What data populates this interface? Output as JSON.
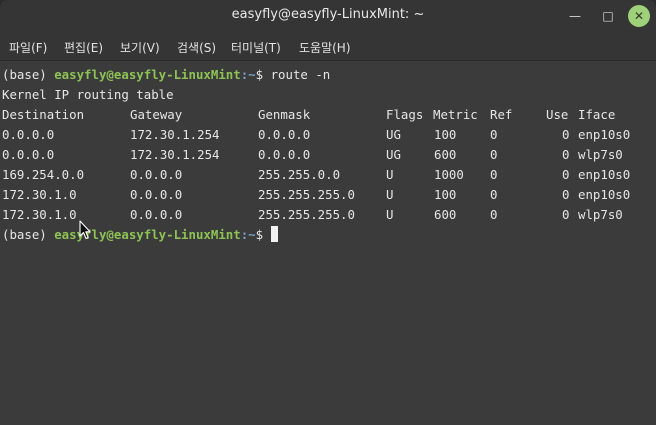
{
  "window": {
    "title": "easyfly@easyfly-LinuxMint: ~",
    "buttons": {
      "minimize": "—",
      "maximize": "□",
      "close": "✕"
    }
  },
  "menu": [
    {
      "label": "파일(F)"
    },
    {
      "label": "편집(E)"
    },
    {
      "label": "보기(V)"
    },
    {
      "label": "검색(S)"
    },
    {
      "label": "터미널(T)"
    },
    {
      "label": "도움말(H)"
    }
  ],
  "terminal": {
    "prompt1": {
      "env": "(base) ",
      "user_host": "easyfly@easyfly-LinuxMint",
      "path": ":~",
      "symbol": "$ ",
      "command": "route -n"
    },
    "table_title": "Kernel IP routing table",
    "columns": [
      "Destination",
      "Gateway",
      "Genmask",
      "Flags",
      "Metric",
      "Ref",
      "Use",
      "Iface"
    ],
    "rows": [
      [
        "0.0.0.0",
        "172.30.1.254",
        "0.0.0.0",
        "UG",
        "100",
        "0",
        "0",
        "enp10s0"
      ],
      [
        "0.0.0.0",
        "172.30.1.254",
        "0.0.0.0",
        "UG",
        "600",
        "0",
        "0",
        "wlp7s0"
      ],
      [
        "169.254.0.0",
        "0.0.0.0",
        "255.255.0.0",
        "U",
        "1000",
        "0",
        "0",
        "enp10s0"
      ],
      [
        "172.30.1.0",
        "0.0.0.0",
        "255.255.255.0",
        "U",
        "100",
        "0",
        "0",
        "enp10s0"
      ],
      [
        "172.30.1.0",
        "0.0.0.0",
        "255.255.255.0",
        "U",
        "600",
        "0",
        "0",
        "wlp7s0"
      ]
    ],
    "prompt2": {
      "env": "(base) ",
      "user_host": "easyfly@easyfly-LinuxMint",
      "path": ":~",
      "symbol": "$ "
    }
  },
  "colors": {
    "prompt_user": "#8ec255",
    "prompt_path": "#7a9dc7",
    "close_button": "#9fd07a",
    "terminal_bg": "#3b3b3b"
  }
}
